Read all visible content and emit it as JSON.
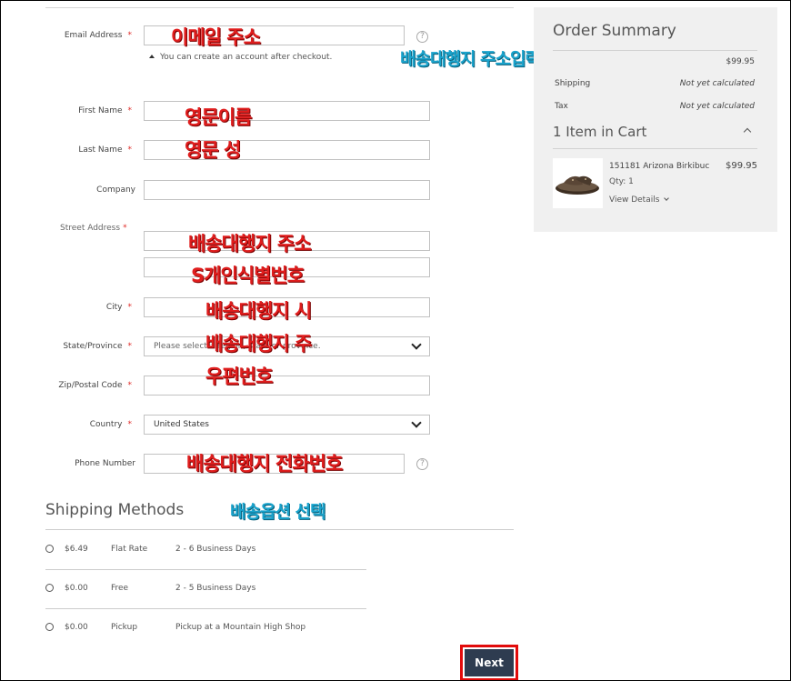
{
  "form": {
    "email": {
      "label": "Email Address",
      "required": "*",
      "value": "",
      "note": "You can create an account after checkout.",
      "help": "?"
    },
    "first_name": {
      "label": "First Name",
      "required": "*",
      "value": ""
    },
    "last_name": {
      "label": "Last Name",
      "required": "*",
      "value": ""
    },
    "company": {
      "label": "Company",
      "value": ""
    },
    "street": {
      "label": "Street Address",
      "required": "*",
      "line1": "",
      "line2": ""
    },
    "city": {
      "label": "City",
      "required": "*",
      "value": ""
    },
    "state": {
      "label": "State/Province",
      "required": "*",
      "value": "Please select a region, state or province."
    },
    "zip": {
      "label": "Zip/Postal Code",
      "required": "*",
      "value": ""
    },
    "country": {
      "label": "Country",
      "required": "*",
      "value": "United States"
    },
    "phone": {
      "label": "Phone Number",
      "value": "",
      "help": "?"
    }
  },
  "annotations": {
    "email": "이메일 주소",
    "proxy_address_input": "배송대행지 주소입력하기",
    "first_name": "영문이름",
    "last_name": "영문 성",
    "street1": "배송대행지 주소",
    "street2": "S개인식별번호",
    "city": "배송대행지 시",
    "state": "배송대행지 주",
    "zip": "우편번호",
    "phone": "배송대행지 전화번호",
    "shipping_option": "배송옵션 선택"
  },
  "shipping": {
    "title": "Shipping Methods",
    "methods": [
      {
        "price": "$6.49",
        "carrier": "Flat Rate",
        "eta": "2 - 6 Business Days"
      },
      {
        "price": "$0.00",
        "carrier": "Free",
        "eta": "2 - 5 Business Days"
      },
      {
        "price": "$0.00",
        "carrier": "Pickup",
        "eta": "Pickup at a Mountain High Shop"
      }
    ]
  },
  "summary": {
    "title": "Order Summary",
    "subtotal_value": "$99.95",
    "shipping_label": "Shipping",
    "shipping_value": "Not yet calculated",
    "tax_label": "Tax",
    "tax_value": "Not yet calculated",
    "cart_title": "1 Item in Cart",
    "item": {
      "name": "151181 Arizona Birkibuc",
      "price": "$99.95",
      "qty": "Qty: 1",
      "details": "View Details"
    }
  },
  "next_button": "Next",
  "icons": {
    "help": "help-circle-icon",
    "select": "chevron-down-icon",
    "note": "caret-up-icon",
    "cart": "chevron-up-icon"
  }
}
